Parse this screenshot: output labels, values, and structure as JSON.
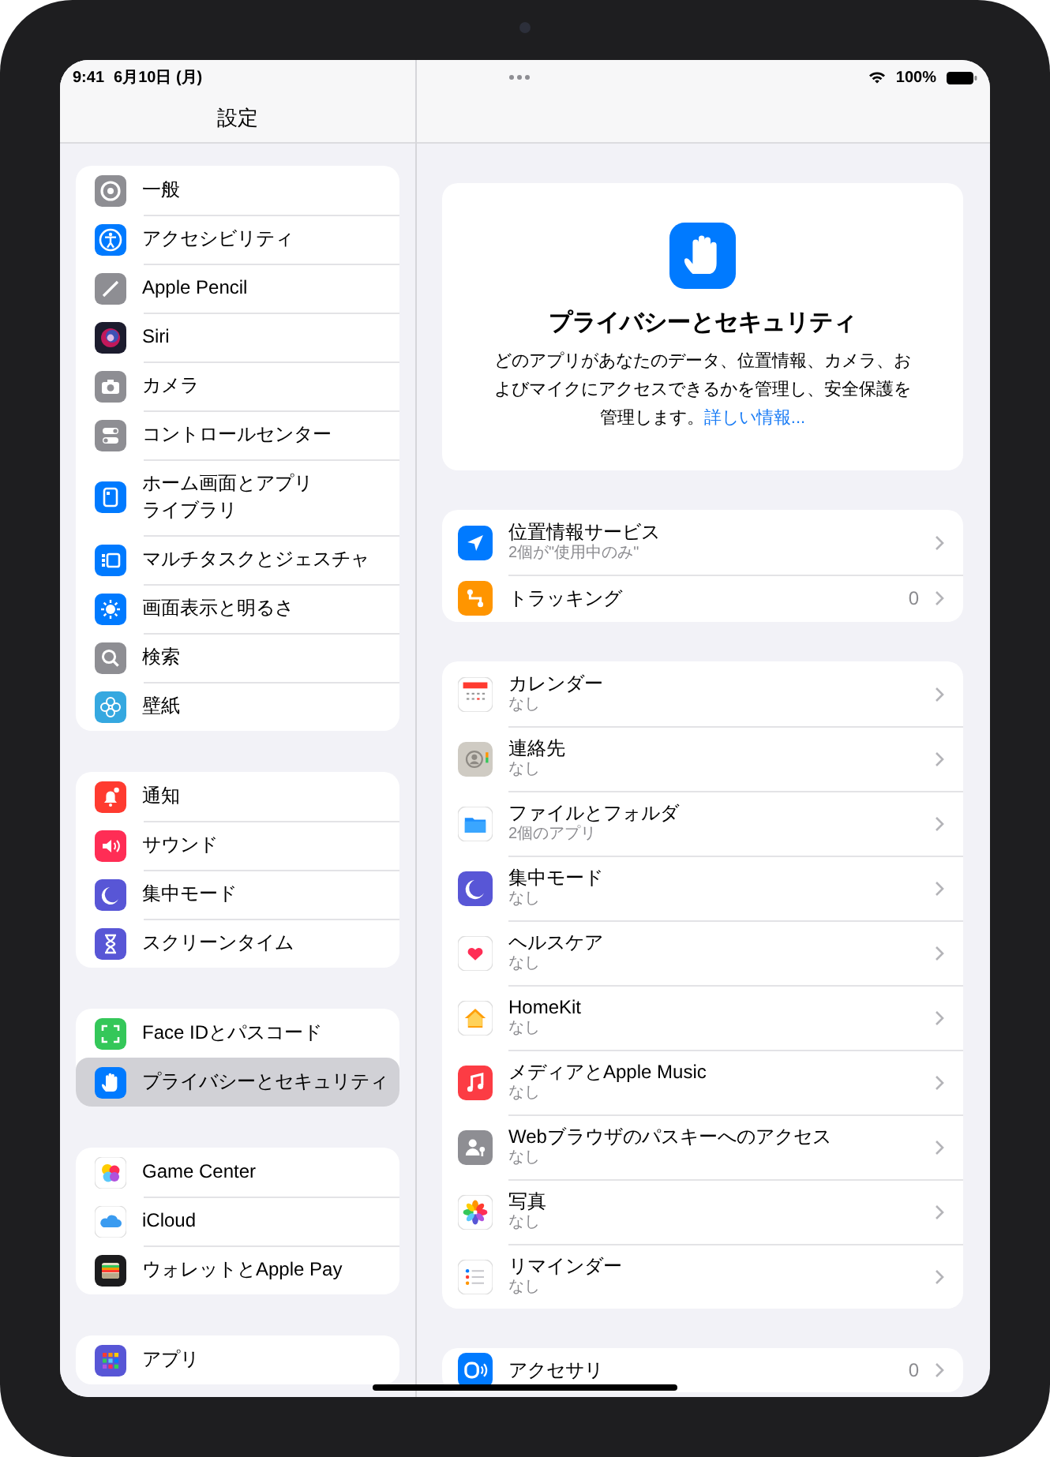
{
  "status_bar": {
    "time": "9:41",
    "date": "6月10日 (月)",
    "battery": "100%"
  },
  "sidebar": {
    "title": "設定",
    "groups": [
      {
        "items": [
          {
            "label": "一般",
            "kind": "gear",
            "selected": false
          },
          {
            "label": "アクセシビリティ",
            "kind": "accessibility",
            "selected": false
          },
          {
            "label": "Apple Pencil",
            "kind": "pencil",
            "selected": false
          },
          {
            "label": "Siri",
            "kind": "orb",
            "selected": false
          },
          {
            "label": "カメラ",
            "kind": "camera",
            "selected": false
          },
          {
            "label": "コントロールセンター",
            "kind": "toggles",
            "selected": false
          },
          {
            "label": "ホーム画面とアプリライブラリ",
            "kind": "tablet",
            "selected": false
          },
          {
            "label": "マルチタスクとジェスチャ",
            "kind": "windows",
            "selected": false
          },
          {
            "label": "画面表示と明るさ",
            "kind": "sun",
            "selected": false
          },
          {
            "label": "検索",
            "kind": "search",
            "selected": false
          },
          {
            "label": "壁紙",
            "kind": "flower",
            "selected": false
          }
        ]
      },
      {
        "items": [
          {
            "label": "通知",
            "kind": "bell",
            "selected": false
          },
          {
            "label": "サウンド",
            "kind": "speaker",
            "selected": false
          },
          {
            "label": "集中モード",
            "kind": "moon",
            "selected": false
          },
          {
            "label": "スクリーンタイム",
            "kind": "hourglass",
            "selected": false
          }
        ]
      },
      {
        "items": [
          {
            "label": "Face IDとパスコード",
            "kind": "facescan",
            "selected": false
          },
          {
            "label": "プライバシーとセキュリティ",
            "kind": "hand",
            "selected": true
          }
        ]
      },
      {
        "items": [
          {
            "label": "Game Center",
            "kind": "bubbles",
            "selected": false
          },
          {
            "label": "iCloud",
            "kind": "cloud",
            "selected": false
          },
          {
            "label": "ウォレットとApple Pay",
            "kind": "wallet",
            "selected": false
          }
        ]
      },
      {
        "items": [
          {
            "label": "アプリ",
            "kind": "grid",
            "selected": false
          }
        ]
      }
    ]
  },
  "detail": {
    "hero": {
      "kind": "hand",
      "title": "プライバシーとセキュリティ",
      "description": "どのアプリがあなたのデータ、位置情報、カメラ、およびマイクにアクセスできるかを管理し、安全保護を管理します。",
      "link": "詳しい情報..."
    },
    "groups": [
      {
        "items": [
          {
            "label": "位置情報サービス",
            "subtitle": "2個が\"使用中のみ\"",
            "kind": "location"
          },
          {
            "label": "トラッキング",
            "value": "0",
            "kind": "route"
          }
        ]
      },
      {
        "items": [
          {
            "label": "カレンダー",
            "subtitle": "なし",
            "kind": "calendar"
          },
          {
            "label": "連絡先",
            "subtitle": "なし",
            "kind": "contact"
          },
          {
            "label": "ファイルとフォルダ",
            "subtitle": "2個のアプリ",
            "kind": "folder"
          },
          {
            "label": "集中モード",
            "subtitle": "なし",
            "kind": "moon"
          },
          {
            "label": "ヘルスケア",
            "subtitle": "なし",
            "kind": "heart"
          },
          {
            "label": "HomeKit",
            "subtitle": "なし",
            "kind": "house"
          },
          {
            "label": "メディアとApple Music",
            "subtitle": "なし",
            "kind": "note"
          },
          {
            "label": "Webブラウザのパスキーへのアクセス",
            "subtitle": "なし",
            "kind": "personkey"
          },
          {
            "label": "写真",
            "subtitle": "なし",
            "kind": "petals"
          },
          {
            "label": "リマインダー",
            "subtitle": "なし",
            "kind": "list"
          }
        ]
      },
      {
        "items": [
          {
            "label": "アクセサリ",
            "value": "0",
            "kind": "device"
          }
        ]
      }
    ]
  }
}
